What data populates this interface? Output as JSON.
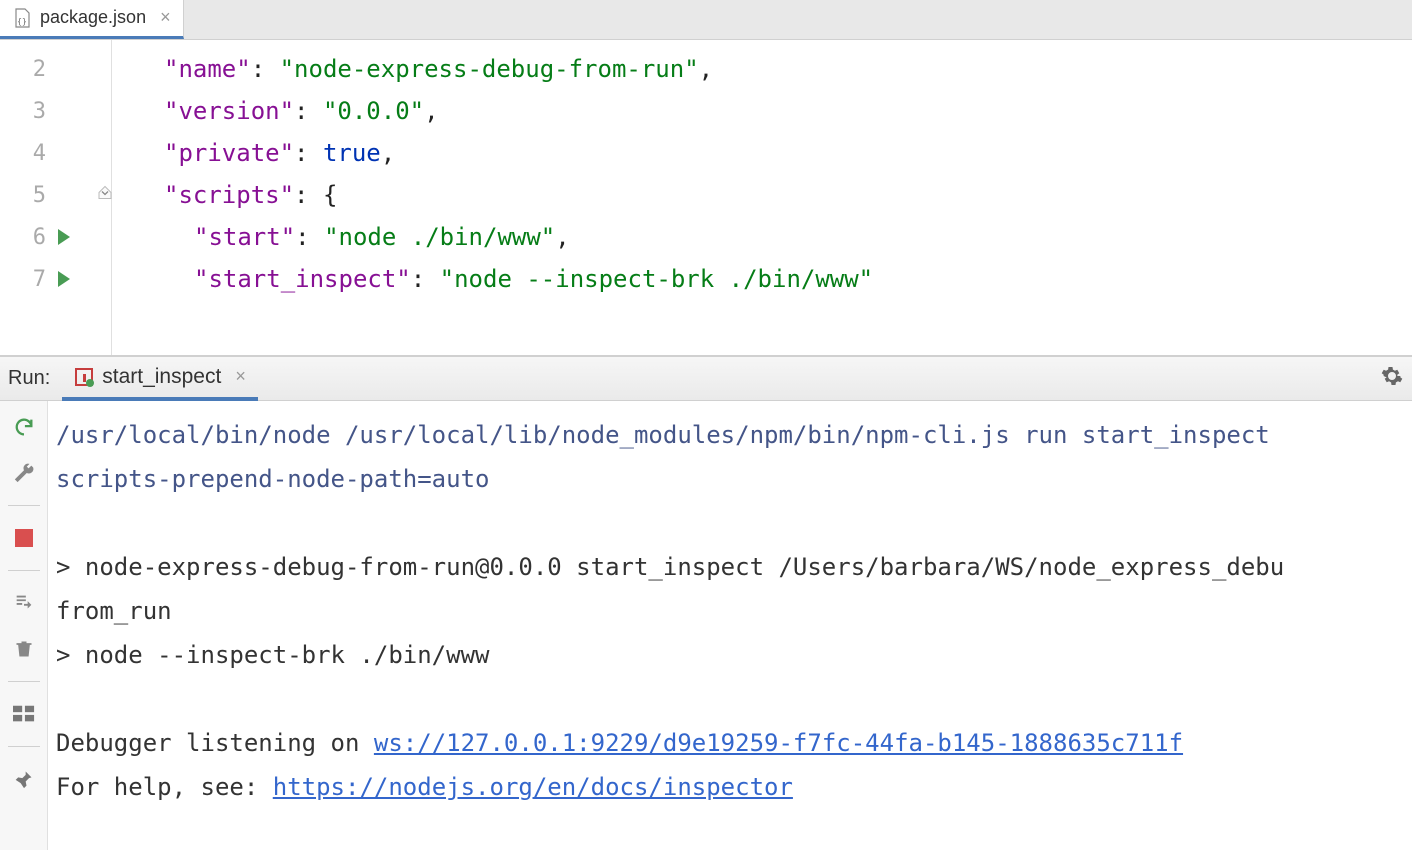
{
  "editor": {
    "tab": {
      "filename": "package.json"
    },
    "lines": [
      {
        "num": "2",
        "runnable": false
      },
      {
        "num": "3",
        "runnable": false
      },
      {
        "num": "4",
        "runnable": false
      },
      {
        "num": "5",
        "runnable": false,
        "foldable": true
      },
      {
        "num": "6",
        "runnable": true
      },
      {
        "num": "7",
        "runnable": true
      }
    ],
    "code": {
      "l2_prop": "\"name\"",
      "l2_val": "\"node-express-debug-from-run\"",
      "l3_prop": "\"version\"",
      "l3_val": "\"0.0.0\"",
      "l4_prop": "\"private\"",
      "l4_val": "true",
      "l5_prop": "\"scripts\"",
      "l6_prop": "\"start\"",
      "l6_val": "\"node ./bin/www\"",
      "l7_prop": "\"start_inspect\"",
      "l7_val": "\"node --inspect-brk ./bin/www\""
    }
  },
  "run": {
    "label": "Run:",
    "tab_name": "start_inspect",
    "console": {
      "cmd1": "/usr/local/bin/node /usr/local/lib/node_modules/npm/bin/npm-cli.js run start_inspect ",
      "cmd2": "scripts-prepend-node-path=auto",
      "out1": "> node-express-debug-from-run@0.0.0 start_inspect /Users/barbara/WS/node_express_debu",
      "out2": "from_run",
      "out3": "> node --inspect-brk ./bin/www",
      "dbg_prefix": "Debugger listening on ",
      "dbg_url": "ws://127.0.0.1:9229/d9e19259-f7fc-44fa-b145-1888635c711f",
      "help_prefix": "For help, see: ",
      "help_url": "https://nodejs.org/en/docs/inspector"
    }
  }
}
